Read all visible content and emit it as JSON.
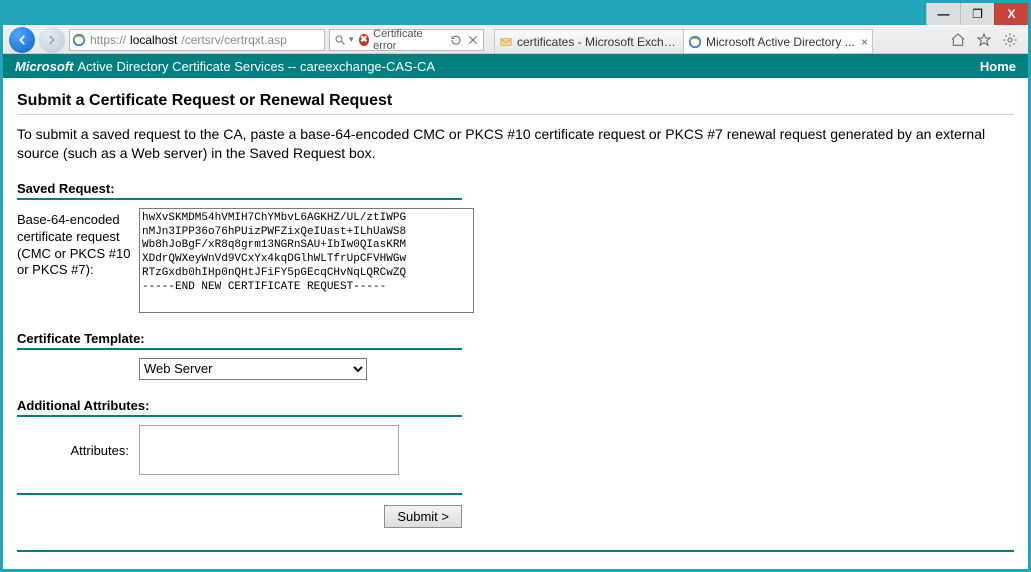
{
  "window": {
    "minimize": "—",
    "maximize": "❐",
    "close": "X"
  },
  "address": {
    "url_prefix": "https://",
    "url_host": "localhost",
    "url_path": "/certsrv/certrqxt.asp"
  },
  "searchbar": {
    "cert_error": "Certificate error"
  },
  "tabs": {
    "inactive": {
      "label": "certificates - Microsoft Exchange"
    },
    "active": {
      "label": "Microsoft Active Directory ..."
    }
  },
  "band": {
    "brand_bold": "Microsoft",
    "brand_rest": " Active Directory Certificate Services  --  careexchange-CAS-CA",
    "home": "Home"
  },
  "page": {
    "title": "Submit a Certificate Request or Renewal Request",
    "description": "To submit a saved request to the CA, paste a base-64-encoded CMC or PKCS #10 certificate request or PKCS #7 renewal request generated by an external source (such as a Web server) in the Saved Request box.",
    "saved_request_label": "Saved Request:",
    "b64_label": "Base-64-encoded certificate request (CMC or PKCS #10 or PKCS #7):",
    "request_text": "hwXvSKMDM54hVMIH7ChYMbvL6AGKHZ/UL/ztIWPG\nnMJn3IPP36o76hPUizPWFZixQeIUast+ILhUaWS8\nWb8hJoBgF/xR8q8grm13NGRnSAU+IbIw0QIasKRM\nXDdrQWXeyWnVd9VCxYx4kqDGlhWLTfrUpCFVHWGw\nRTzGxdb0hIHp0nQHtJFiFY5pGEcqCHvNqLQRCwZQ\n-----END NEW CERTIFICATE REQUEST-----",
    "template_label": "Certificate Template:",
    "template_value": "Web Server",
    "addl_label": "Additional Attributes:",
    "attributes_label": "Attributes:",
    "attributes_value": "",
    "submit": "Submit >"
  }
}
